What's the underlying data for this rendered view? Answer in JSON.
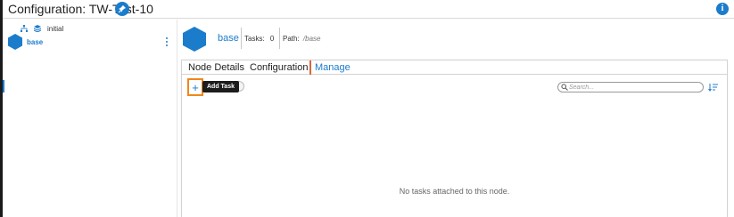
{
  "header": {
    "title": "Configuration: TW-Test-10"
  },
  "tree": {
    "root": {
      "label": "initial"
    },
    "node": {
      "label": "base"
    }
  },
  "node": {
    "name": "base",
    "tasks_label": "Tasks:",
    "tasks_count": "0",
    "path_label": "Path:",
    "path_value": "/base"
  },
  "tabs": [
    {
      "label": "Node Details",
      "active": false
    },
    {
      "label": "Configuration",
      "active": false
    },
    {
      "label": "Manage",
      "active": true
    }
  ],
  "manage": {
    "add_button_label": "+",
    "tooltip": "Add Task",
    "search_placeholder": "Search...",
    "empty_message": "No tasks attached to this node."
  },
  "colors": {
    "accent": "#1b7ccc",
    "highlight_border": "#f0871b",
    "tooltip_bg": "#1c1c1c"
  },
  "icons": {
    "header_pin": "pin-icon",
    "header_info": "info-icon",
    "tree_hierarchy": "hierarchy-icon",
    "tree_layers": "layers-icon",
    "node": "hexagon-icon",
    "search": "search-icon",
    "sort": "sort-icon"
  }
}
